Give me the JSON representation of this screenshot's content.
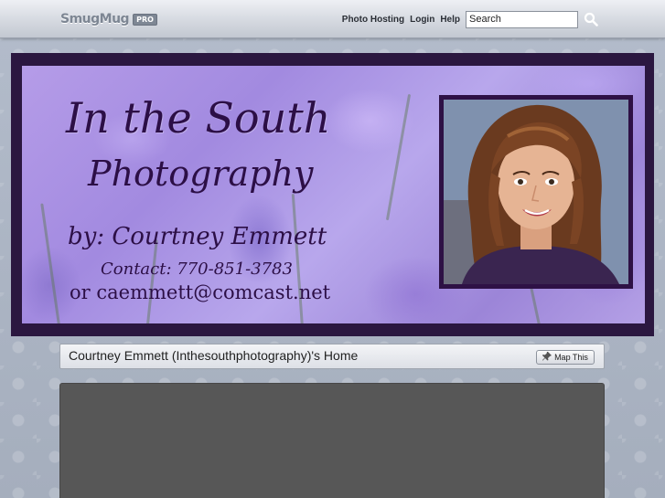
{
  "topbar": {
    "logo_text": "SmugMug",
    "logo_badge": "PRO",
    "nav": [
      "Photo Hosting",
      "Login",
      "Help"
    ],
    "search_placeholder": "Search",
    "search_icon": "magnifier-icon"
  },
  "banner": {
    "title": "In the South",
    "subtitle": "Photography",
    "byline": "by: Courtney Emmett",
    "contact": "Contact: 770-851-3783",
    "email": "or caemmett@comcast.net",
    "portrait_icon": "portrait-photo"
  },
  "home": {
    "title": "Courtney Emmett (Inthesouthphotography)'s Home",
    "map_button": "Map This",
    "map_icon": "pushpin-icon"
  },
  "colors": {
    "banner_frame": "#2b1740",
    "banner_text": "#2c0f46",
    "content_box": "#575757"
  }
}
